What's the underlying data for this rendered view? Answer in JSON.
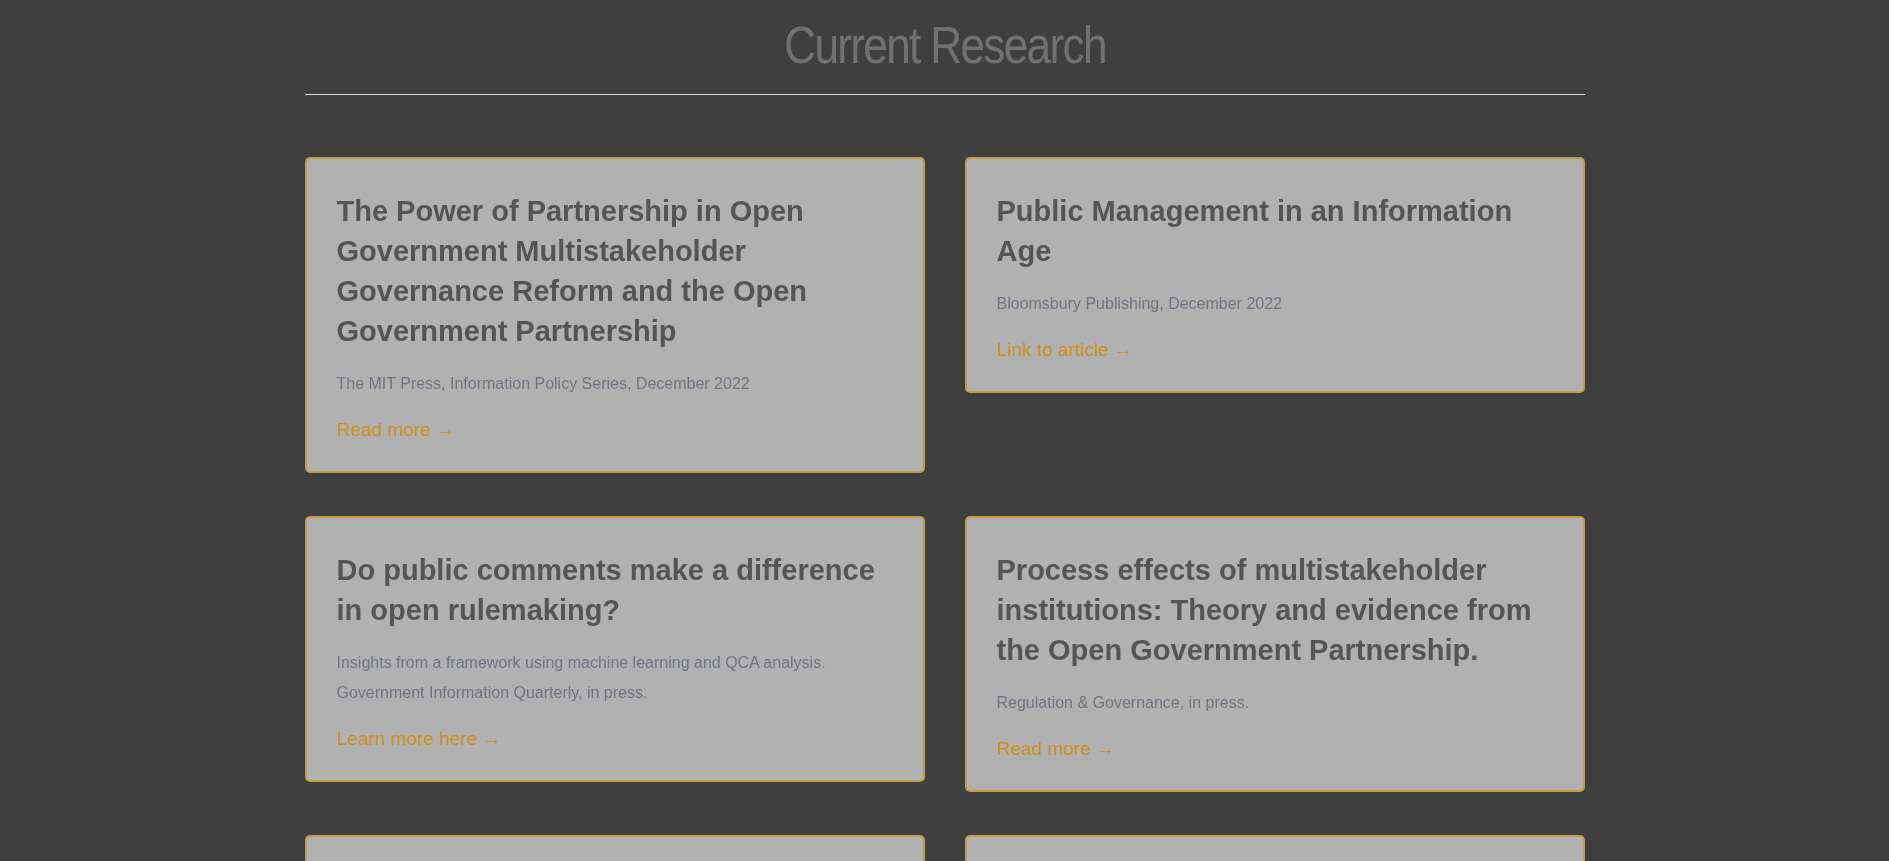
{
  "heading": "Current Research",
  "cards": [
    {
      "kind": "full",
      "title": "The Power of Partnership in Open Government Multistakeholder Governance Reform and the Open Government Partnership",
      "meta": [
        "The MIT Press, Information Policy Series, December 2022"
      ],
      "link": "Read more →"
    },
    {
      "kind": "full",
      "title": "Public Management in an Information Age",
      "meta": [
        "Bloomsbury Publishing, December 2022"
      ],
      "link": "Link to article →"
    },
    {
      "kind": "full",
      "title": "Do public comments make a difference in open rulemaking?",
      "meta": [
        "Insights from a framework using machine learning and QCA analysis.",
        "Government Information Quarterly, in press."
      ],
      "link": "Learn more here →"
    },
    {
      "kind": "full",
      "title": "Process effects of multistakeholder institutions: Theory and evidence from the Open Government Partnership.",
      "meta": [
        "Regulation & Governance, in press."
      ],
      "link": "Read more →"
    },
    {
      "kind": "cut_off"
    },
    {
      "kind": "cut_off"
    }
  ]
}
